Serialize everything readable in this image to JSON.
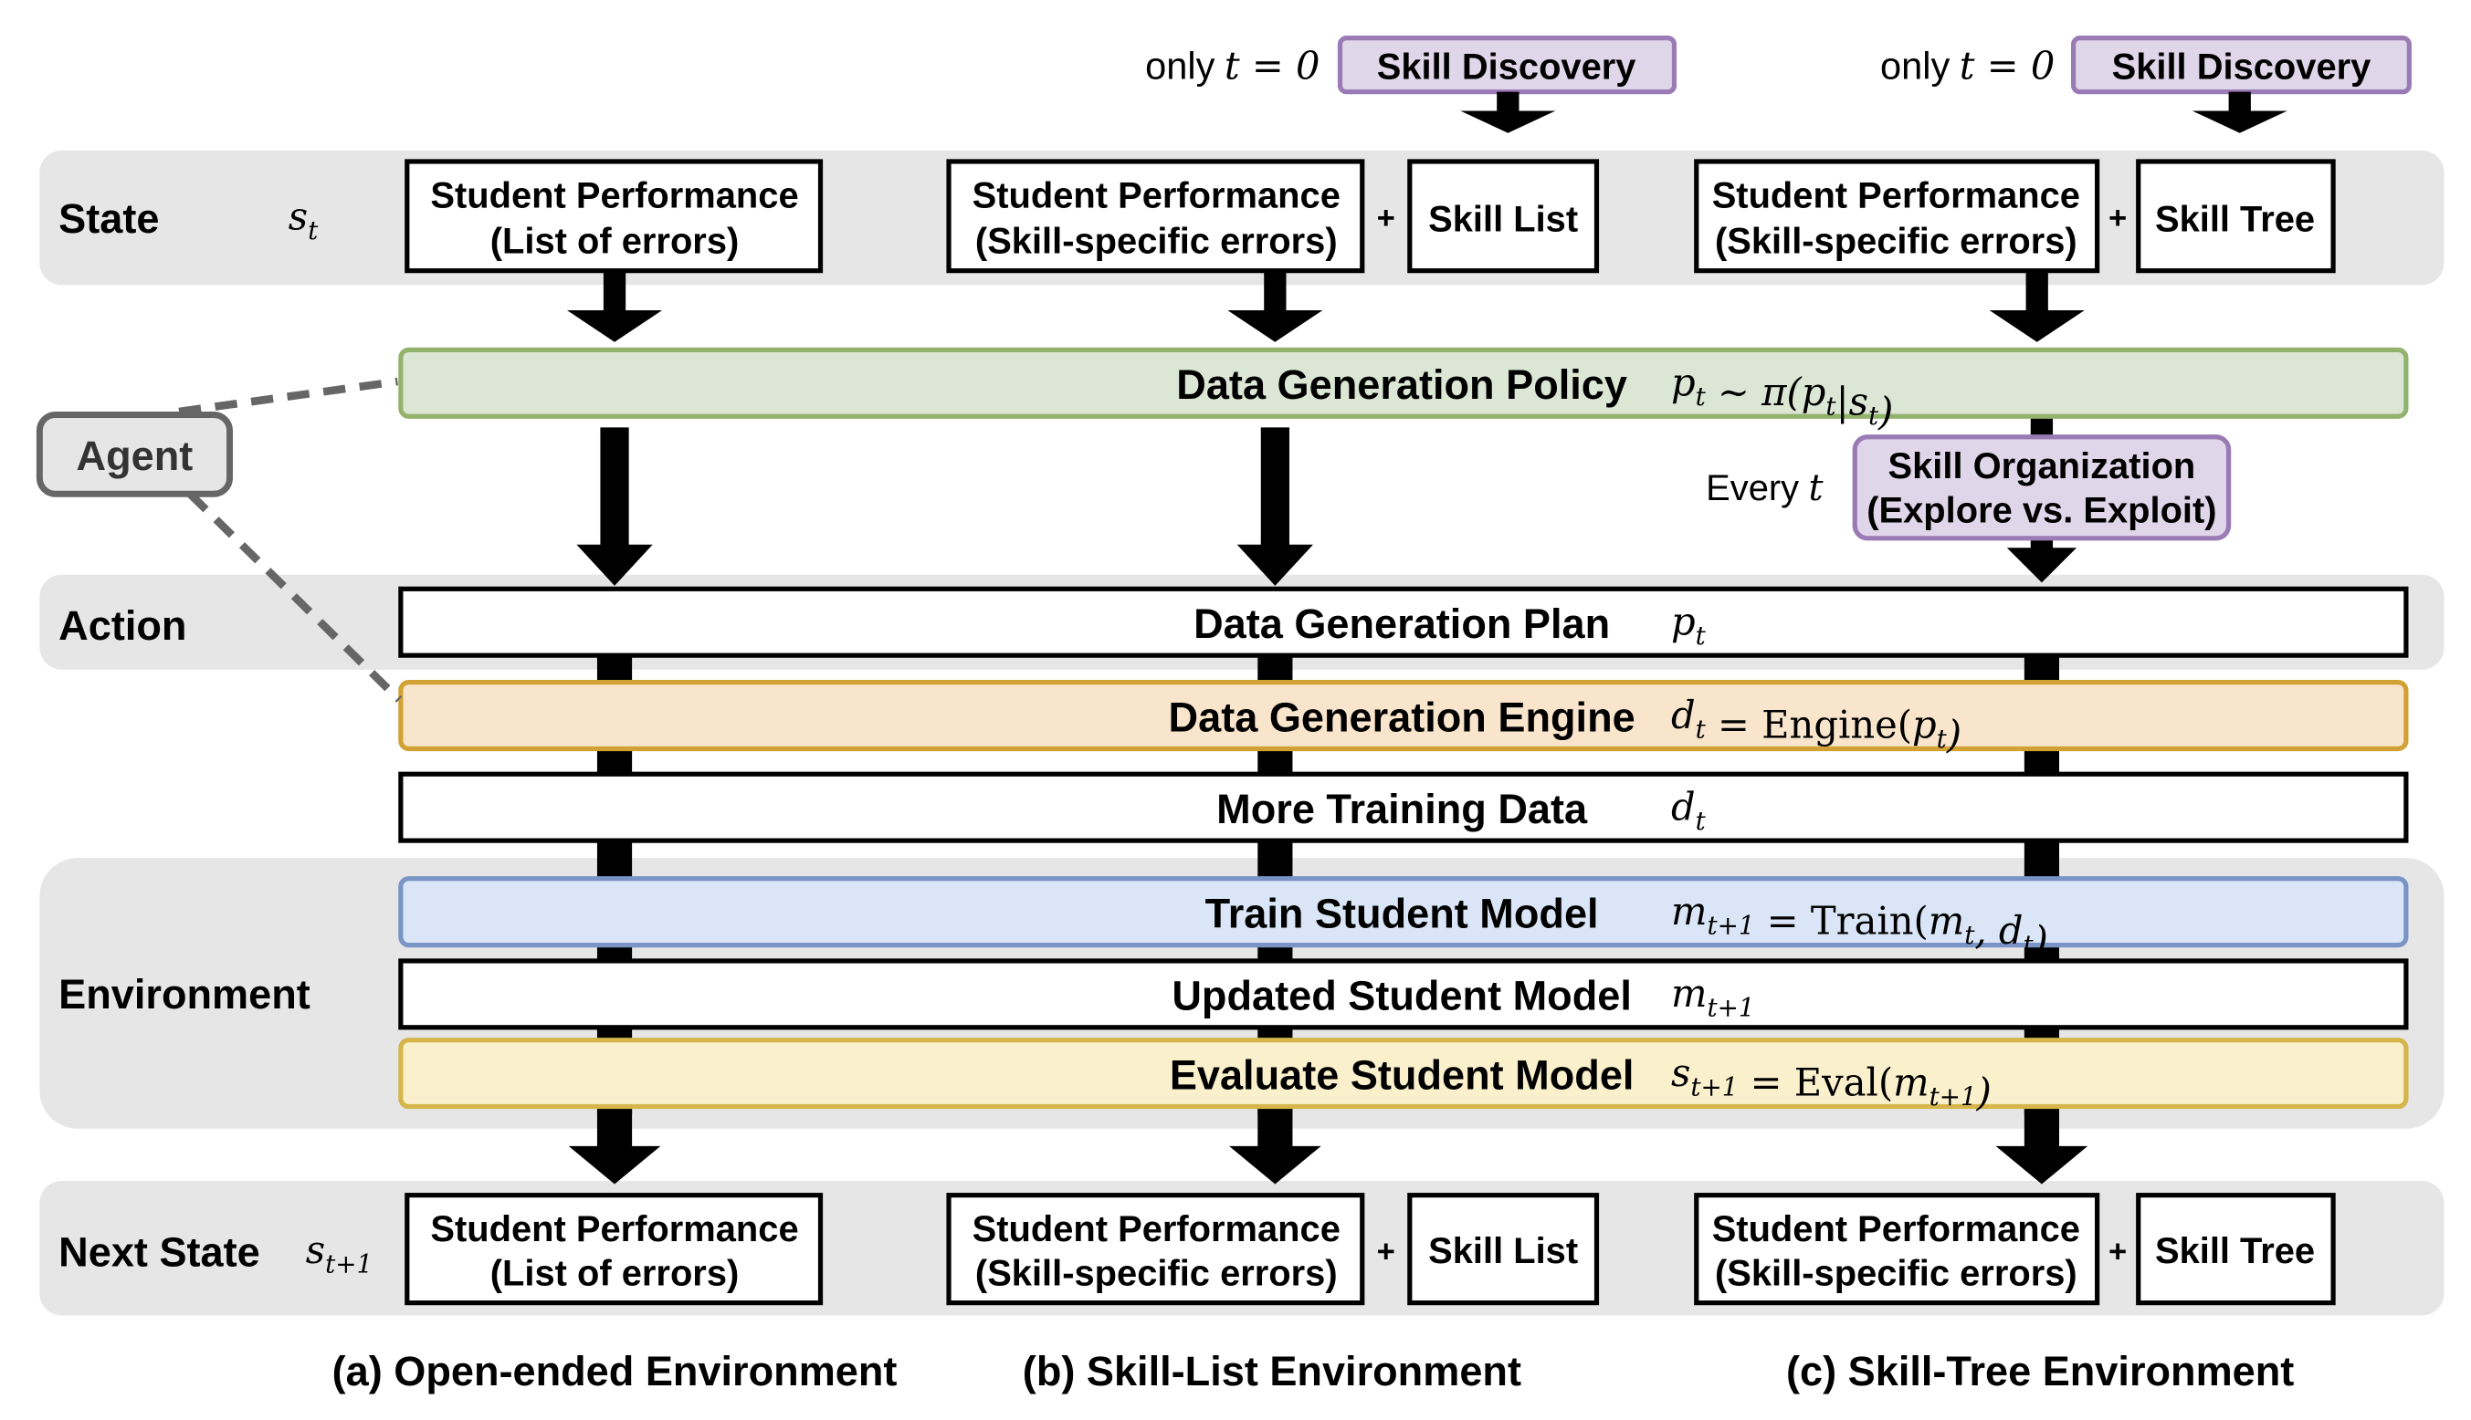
{
  "colors": {
    "band": "#e6e6e6",
    "policy_fill": "#dbe6d4",
    "policy_stroke": "#93b26c",
    "engine_fill": "#f9e5cc",
    "engine_stroke": "#d2a133",
    "train_fill": "#dae6f7",
    "train_stroke": "#7a95c5",
    "eval_fill": "#faf0cc",
    "eval_stroke": "#d6b64a",
    "skill_fill": "#e0d6ea",
    "skill_stroke": "#9b7bb5",
    "agent_stroke": "#666666"
  },
  "rows": {
    "state": "State",
    "state_var": "s",
    "state_sub": "t",
    "action": "Action",
    "environment": "Environment",
    "next_state": "Next State",
    "next_var": "s",
    "next_sub": "t+1"
  },
  "agent": "Agent",
  "top": {
    "only_t0": "only",
    "t0_math": "t = 0",
    "skill_discovery": "Skill Discovery",
    "every": "Every",
    "every_t": "t",
    "skill_org_1": "Skill Organization",
    "skill_org_2": "(Explore vs. Exploit)"
  },
  "state_boxes": {
    "a_1": "Student Performance",
    "a_2": "(List of errors)",
    "b_1": "Student Performance",
    "b_2": "(Skill-specific errors)",
    "skill_list": "Skill List",
    "c_1": "Student Performance",
    "c_2": "(Skill-specific errors)",
    "skill_tree": "Skill Tree",
    "plus": "+"
  },
  "pipeline": [
    {
      "label": "Data Generation Policy",
      "formula": [
        [
          "p",
          "t"
        ],
        [
          " ∼ π(",
          ""
        ],
        [
          "p",
          "t"
        ],
        [
          "|",
          ""
        ],
        [
          "s",
          "t"
        ],
        [
          ")",
          ""
        ]
      ]
    },
    {
      "label": "Data Generation Plan",
      "formula": [
        [
          "p",
          "t"
        ]
      ]
    },
    {
      "label": "Data Generation Engine",
      "formula": [
        [
          "d",
          "t"
        ],
        [
          " = Engine(",
          ""
        ],
        [
          "p",
          "t"
        ],
        [
          ")",
          ""
        ]
      ]
    },
    {
      "label": "More Training Data",
      "formula": [
        [
          "d",
          "t"
        ]
      ]
    },
    {
      "label": "Train Student Model",
      "formula": [
        [
          "m",
          "t+1"
        ],
        [
          " = Train(",
          ""
        ],
        [
          "m",
          "t"
        ],
        [
          ", ",
          ""
        ],
        [
          "d",
          "t"
        ],
        [
          ")",
          ""
        ]
      ]
    },
    {
      "label": "Updated Student Model",
      "formula": [
        [
          "m",
          "t+1"
        ]
      ]
    },
    {
      "label": "Evaluate Student Model",
      "formula": [
        [
          "s",
          "t+1"
        ],
        [
          " = Eval(",
          ""
        ],
        [
          "m",
          "t+1"
        ],
        [
          ")",
          ""
        ]
      ]
    }
  ],
  "captions": {
    "a": "(a) Open-ended Environment",
    "b": "(b) Skill-List Environment",
    "c": "(c) Skill-Tree Environment"
  }
}
